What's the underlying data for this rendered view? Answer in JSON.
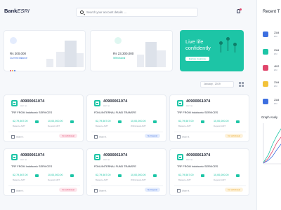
{
  "header": {
    "logo_bold": "Bank",
    "logo_italic": "ESRI",
    "search_placeholder": "Search your account details ....",
    "icons": [
      "search-icon",
      "bell-icon"
    ]
  },
  "balances": [
    {
      "amount": "Rs 200,000",
      "sub": "Current balance",
      "accent": "#3d6fe0",
      "sub_color": "#3d6fe0"
    },
    {
      "amount": "Rs 23,300,000",
      "sub": "Withdrawal",
      "accent": "#1dc5a6",
      "sub_color": "#1dc5a6"
    }
  ],
  "dots_colors": [
    "#e0456b",
    "#f2a23a",
    "#3d6fe0"
  ],
  "promo": {
    "title": "Live life confidently",
    "button": "Explore insurance",
    "color": "#1dc5a6"
  },
  "filter": {
    "date": "January , 2019"
  },
  "accounts": [
    {
      "number": "40900061074",
      "label": "Acc no.",
      "transfer": "TRF FROM Indofocnic SERVICES",
      "balance": "62,79,567.00",
      "balance_label": "Balance AMT",
      "deposit": "10,00,000.00",
      "deposit_label": "Deposit AMT",
      "share": "Share it",
      "badge": "No withdrawal",
      "badge_color": "#e0456b",
      "badge_bg": "#fde6ec"
    },
    {
      "number": "40900061074",
      "label": "Acc no.",
      "transfer": "FDNL/INTERNAL FUND TRANSFE",
      "balance": "62,79,567.00",
      "balance_label": "Balance AMT",
      "deposit": "10,00,000.00",
      "deposit_label": "Withdrawal AMT",
      "share": "Share it",
      "badge": "No Deposit",
      "badge_color": "#3d6fe0",
      "badge_bg": "#e4ecfd"
    },
    {
      "number": "40900061074",
      "label": "Acc no.",
      "transfer": "TRF FROM Indofocnic SERVICES",
      "balance": "62,79,567.00",
      "balance_label": "Balance AMT",
      "deposit": "10,00,000.00",
      "deposit_label": "Deposit AMT",
      "share": "Share it",
      "badge": "No withdrawal",
      "badge_color": "#e8a21a",
      "badge_bg": "#fdf2dc"
    },
    {
      "number": "40900061074",
      "label": "Acc no.",
      "transfer": "TRF FROM Indofocnic SERVICES",
      "balance": "62,79,567.00",
      "balance_label": "Balance AMT",
      "deposit": "10,00,000.00",
      "deposit_label": "Deposit AMT",
      "share": "Share it",
      "badge": "No withdrawal",
      "badge_color": "#e0456b",
      "badge_bg": "#fde6ec"
    },
    {
      "number": "40900061074",
      "label": "Acc no.",
      "transfer": "FDNL/INTERNAL FUND TRANSFE",
      "balance": "62,79,567.00",
      "balance_label": "Balance AMT",
      "deposit": "10,00,000.00",
      "deposit_label": "Withdrawal AMT",
      "share": "Share it",
      "badge": "No Deposit",
      "badge_color": "#3d6fe0",
      "badge_bg": "#e4ecfd"
    },
    {
      "number": "40900061074",
      "label": "Acc no.",
      "transfer": "TRF FROM Indofocnic SERVICES",
      "balance": "62,79,567.00",
      "balance_label": "Balance AMT",
      "deposit": "10,00,000.00",
      "deposit_label": "Deposit AMT",
      "share": "Share it",
      "badge": "No withdrawal",
      "badge_color": "#e8a21a",
      "badge_bg": "#fdf2dc"
    }
  ],
  "recent": {
    "title": "Recent T",
    "rows": [
      {
        "num": "2344",
        "sub": "EM",
        "color": "#3d6fe0"
      },
      {
        "num": "2344",
        "sub": "EM",
        "color": "#1dc5a6"
      },
      {
        "num": "4812",
        "sub": "EM",
        "color": "#e0456b"
      },
      {
        "num": "2344",
        "sub": "EM",
        "color": "#f2c23a"
      },
      {
        "num": "2344",
        "sub": "EM",
        "color": "#3d6fe0"
      }
    ]
  },
  "graph": {
    "title": "Graph Analy"
  }
}
